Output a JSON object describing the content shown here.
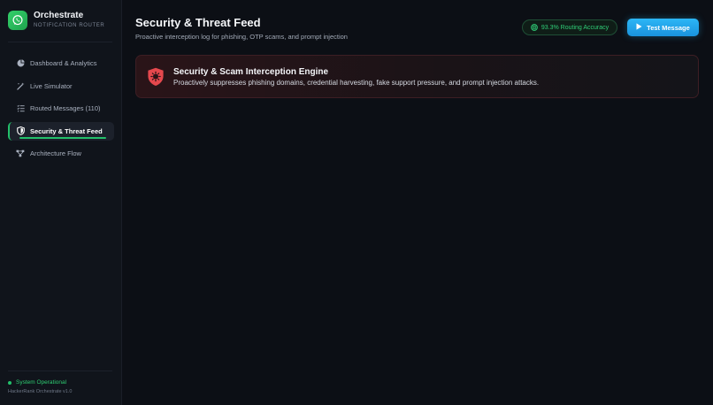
{
  "brand": {
    "title": "Orchestrate",
    "subtitle": "NOTIFICATION ROUTER",
    "logo_icon": "whatsapp-icon",
    "color": "#2bc35f"
  },
  "sidebar": {
    "items": [
      {
        "label": "Dashboard & Analytics",
        "icon": "pie-chart-icon",
        "active": false
      },
      {
        "label": "Live Simulator",
        "icon": "magic-wand-icon",
        "active": false
      },
      {
        "label": "Routed Messages (110)",
        "icon": "list-icon",
        "active": false
      },
      {
        "label": "Security & Threat Feed",
        "icon": "shield-icon",
        "active": true
      },
      {
        "label": "Architecture Flow",
        "icon": "network-icon",
        "active": false
      }
    ],
    "status": "System Operational",
    "version": "HackerRank Orchestrate v1.0"
  },
  "header": {
    "title": "Security & Threat Feed",
    "subtitle": "Proactive interception log for phishing, OTP scams, and prompt injection",
    "accuracy_badge": "93.3% Routing Accuracy",
    "test_button": "Test Message"
  },
  "engine_card": {
    "title": "Security & Scam Interception Engine",
    "description": "Proactively suppresses phishing domains, credential harvesting, fake support pressure, and prompt injection attacks.",
    "icon": "shield-virus-icon"
  },
  "colors": {
    "accent_green": "#23c16b",
    "accent_blue": "#2cb6f6",
    "danger_red": "#e5484d",
    "background": "#0c0f15"
  }
}
